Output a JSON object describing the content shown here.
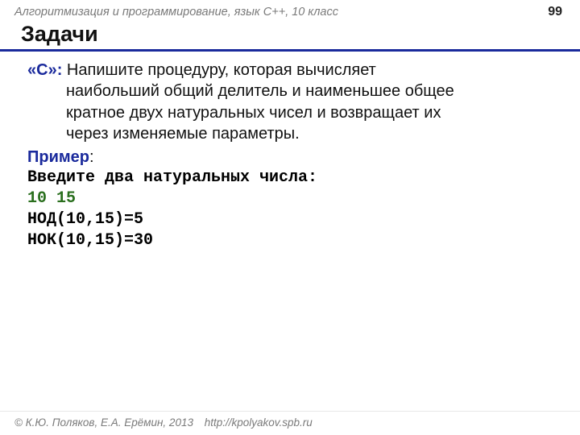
{
  "header": {
    "course": "Алгоритмизация и программирование, язык  C++, 10 класс",
    "page": "99"
  },
  "title": "Задачи",
  "task": {
    "marker": "«С»:",
    "line1_rest": " Напишите процедуру, которая вычисляет",
    "line2": "наибольший общий делитель и наименьшее общее",
    "line3": "кратное двух натуральных чисел и возвращает их",
    "line4": "через изменяемые параметры."
  },
  "example": {
    "label": "Пример",
    "colon": ":",
    "prompt": "Введите два натуральных числа:",
    "input": "10 15",
    "out1": "НОД(10,15)=5",
    "out2": "НОК(10,15)=30"
  },
  "footer": {
    "copyright": "© К.Ю. Поляков, Е.А. Ерёмин, 2013",
    "url": "http://kpolyakov.spb.ru"
  }
}
